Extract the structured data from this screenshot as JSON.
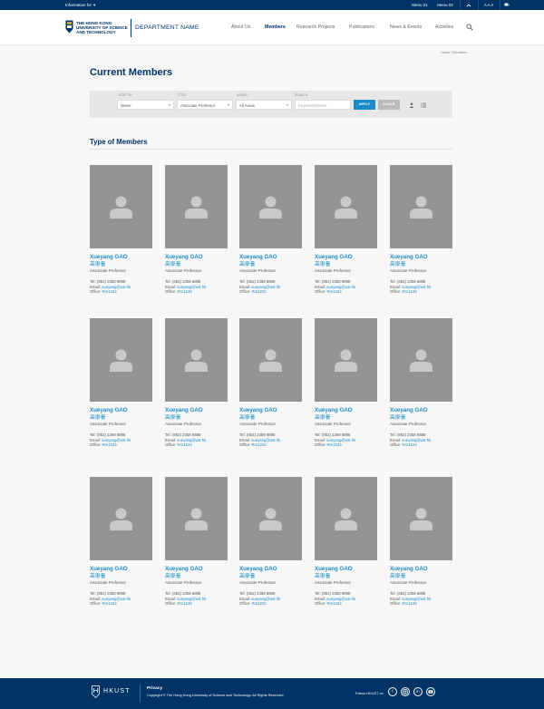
{
  "topbar": {
    "info_label": "Information for",
    "menu1": "Menu 01",
    "menu2": "Menu 02",
    "font_size": "A A A"
  },
  "header": {
    "university": [
      "THE HONG KONG",
      "UNIVERSITY OF SCIENCE",
      "AND TECHNOLOGY"
    ],
    "department": "DEPARTMENT NAME",
    "nav": [
      "About Us",
      "Members",
      "Research Projects",
      "Publications",
      "News & Events",
      "Activities"
    ],
    "active_nav": "Members"
  },
  "breadcrumb": "Home  /  Members",
  "page_title": "Current Members",
  "filters": {
    "sort_by": {
      "label": "SORT BY",
      "value": "Name"
    },
    "title": {
      "label": "TITLE",
      "value": "Associate Professor"
    },
    "areas": {
      "label": "AREAS",
      "value": "All Areas"
    },
    "search": {
      "label": "SEARCH",
      "placeholder": "Keywords/Name"
    },
    "apply_label": "APPLY",
    "clear_label": "CLEAR"
  },
  "section_title": "Type of Members",
  "members": [
    {
      "name": "Xueyang GAO",
      "chinese": "高學養",
      "title": "Associate Professor",
      "tel": "(852) 2358 8888",
      "email": "xueyang@ust.hk",
      "office": "Rm1234"
    },
    {
      "name": "Xueyang GAO",
      "chinese": "高學養",
      "title": "Associate Professor",
      "tel": "(852) 2358 8888",
      "email": "xueyang@ust.hk",
      "office": "Rm1234"
    },
    {
      "name": "Xueyang GAO",
      "chinese": "高學養",
      "title": "Associate Professor",
      "tel": "(852) 2358 8888",
      "email": "xueyang@ust.hk",
      "office": "Rm1234"
    },
    {
      "name": "Xueyang GAO",
      "chinese": "高學養",
      "title": "Associate Professor",
      "tel": "(852) 2358 8888",
      "email": "xueyang@ust.hk",
      "office": "Rm1234"
    },
    {
      "name": "Xueyang GAO",
      "chinese": "高學養",
      "title": "Associate Professor",
      "tel": "(852) 2358 8888",
      "email": "xueyang@ust.hk",
      "office": "Rm1234"
    },
    {
      "name": "Xueyang GAO",
      "chinese": "高學養",
      "title": "Associate Professor",
      "tel": "(852) 2358 8888",
      "email": "xueyang@ust.hk",
      "office": "Rm1234"
    },
    {
      "name": "Xueyang GAO",
      "chinese": "高學養",
      "title": "Associate Professor",
      "tel": "(852) 2358 8888",
      "email": "xueyang@ust.hk",
      "office": "Rm1234"
    },
    {
      "name": "Xueyang GAO",
      "chinese": "高學養",
      "title": "Associate Professor",
      "tel": "(852) 2358 8888",
      "email": "xueyang@ust.hk",
      "office": "Rm1234"
    },
    {
      "name": "Xueyang GAO",
      "chinese": "高學養",
      "title": "Associate Professor",
      "tel": "(852) 2358 8888",
      "email": "xueyang@ust.hk",
      "office": "Rm1234"
    },
    {
      "name": "Xueyang GAO",
      "chinese": "高學養",
      "title": "Associate Professor",
      "tel": "(852) 2358 8888",
      "email": "xueyang@ust.hk",
      "office": "Rm1234"
    },
    {
      "name": "Xueyang GAO",
      "chinese": "高學養",
      "title": "Associate Professor",
      "tel": "(852) 2358 8888",
      "email": "xueyang@ust.hk",
      "office": "Rm1234"
    },
    {
      "name": "Xueyang GAO",
      "chinese": "高學養",
      "title": "Associate Professor",
      "tel": "(852) 2358 8888",
      "email": "xueyang@ust.hk",
      "office": "Rm1234"
    },
    {
      "name": "Xueyang GAO",
      "chinese": "高學養",
      "title": "Associate Professor",
      "tel": "(852) 2358 8888",
      "email": "xueyang@ust.hk",
      "office": "Rm1234"
    },
    {
      "name": "Xueyang GAO",
      "chinese": "高學養",
      "title": "Associate Professor",
      "tel": "(852) 2358 8888",
      "email": "xueyang@ust.hk",
      "office": "Rm1234"
    },
    {
      "name": "Xueyang GAO",
      "chinese": "高學養",
      "title": "Associate Professor",
      "tel": "(852) 2358 8888",
      "email": "xueyang@ust.hk",
      "office": "Rm1234"
    }
  ],
  "labels": {
    "tel": "Tel:",
    "email": "Email:",
    "office": "Office:"
  },
  "footer": {
    "brand": "HKUST",
    "privacy": "Privacy",
    "copyright": "Copyright © The Hong Kong University of Science and Technology. All Rights Reserved.",
    "follow": "Follow HKUST on",
    "social_icons": [
      "facebook-icon",
      "instagram-icon",
      "linkedin-icon",
      "youtube-icon"
    ]
  },
  "colors": {
    "navy": "#003366",
    "accent": "#1a8bc4",
    "photo_placeholder": "#949494"
  }
}
